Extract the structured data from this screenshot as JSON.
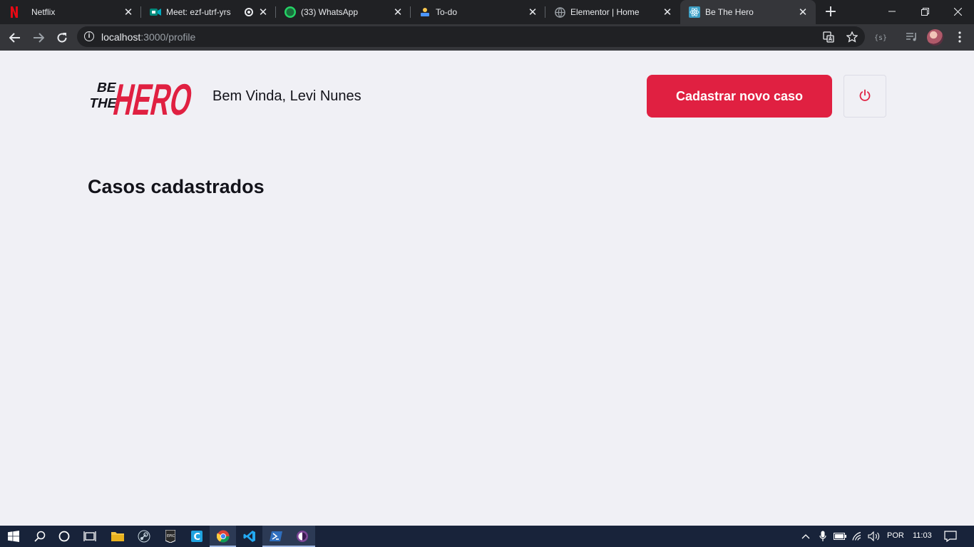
{
  "browser": {
    "tabs": [
      {
        "title": "Netflix",
        "icon": "netflix-icon"
      },
      {
        "title": "Meet: ezf-utrf-yrs",
        "icon": "google-meet-icon"
      },
      {
        "title": "(33) WhatsApp",
        "icon": "whatsapp-icon",
        "badge": "33"
      },
      {
        "title": "To-do",
        "icon": "todo-icon"
      },
      {
        "title": "Elementor | Home",
        "icon": "globe-icon"
      },
      {
        "title": "Be The Hero",
        "icon": "react-icon"
      }
    ],
    "url_host": "localhost",
    "url_path": ":3000/profile"
  },
  "app": {
    "logo": {
      "line1": "BE",
      "line2": "THE",
      "word": "HERO"
    },
    "welcome": "Bem Vinda, Levi Nunes",
    "new_case_label": "Cadastrar novo caso",
    "cases_title": "Casos cadastrados",
    "accent_color": "#e02041"
  },
  "taskbar": {
    "language": "POR",
    "time": "11:03"
  }
}
